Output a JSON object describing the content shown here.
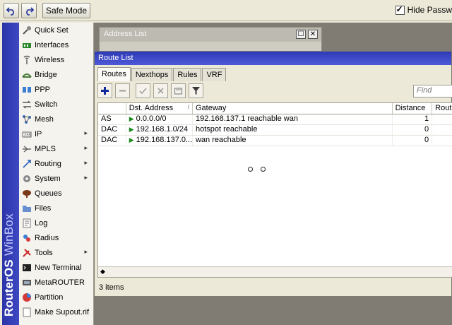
{
  "toolbar": {
    "undo_icon": "undo-icon",
    "redo_icon": "redo-icon",
    "safe_mode": "Safe Mode",
    "hide_passwords": "Hide Passw"
  },
  "brand": {
    "part1": "RouterOS",
    "part2": " WinBox"
  },
  "menu": {
    "items": [
      {
        "label": "Quick Set",
        "icon": "quickset-icon",
        "submenu": false
      },
      {
        "label": "Interfaces",
        "icon": "interfaces-icon",
        "submenu": false
      },
      {
        "label": "Wireless",
        "icon": "wireless-icon",
        "submenu": false
      },
      {
        "label": "Bridge",
        "icon": "bridge-icon",
        "submenu": false
      },
      {
        "label": "PPP",
        "icon": "ppp-icon",
        "submenu": false
      },
      {
        "label": "Switch",
        "icon": "switch-icon",
        "submenu": false
      },
      {
        "label": "Mesh",
        "icon": "mesh-icon",
        "submenu": false
      },
      {
        "label": "IP",
        "icon": "ip-icon",
        "submenu": true
      },
      {
        "label": "MPLS",
        "icon": "mpls-icon",
        "submenu": true
      },
      {
        "label": "Routing",
        "icon": "routing-icon",
        "submenu": true
      },
      {
        "label": "System",
        "icon": "system-icon",
        "submenu": true
      },
      {
        "label": "Queues",
        "icon": "queues-icon",
        "submenu": false
      },
      {
        "label": "Files",
        "icon": "files-icon",
        "submenu": false
      },
      {
        "label": "Log",
        "icon": "log-icon",
        "submenu": false
      },
      {
        "label": "Radius",
        "icon": "radius-icon",
        "submenu": false
      },
      {
        "label": "Tools",
        "icon": "tools-icon",
        "submenu": true
      },
      {
        "label": "New Terminal",
        "icon": "terminal-icon",
        "submenu": false
      },
      {
        "label": "MetaROUTER",
        "icon": "metarouter-icon",
        "submenu": false
      },
      {
        "label": "Partition",
        "icon": "partition-icon",
        "submenu": false
      },
      {
        "label": "Make Supout.rif",
        "icon": "supout-icon",
        "submenu": false
      }
    ]
  },
  "address_list": {
    "title": "Address List"
  },
  "route_list": {
    "title": "Route List",
    "tabs": [
      "Routes",
      "Nexthops",
      "Rules",
      "VRF"
    ],
    "find_placeholder": "Find",
    "columns": [
      "",
      "Dst. Address",
      "Gateway",
      "Distance",
      "Routi"
    ],
    "rows": [
      {
        "flag": "AS",
        "dst": "0.0.0.0/0",
        "gateway": "192.168.137.1 reachable wan",
        "distance": "1"
      },
      {
        "flag": "DAC",
        "dst": "192.168.1.0/24",
        "gateway": "hotspot reachable",
        "distance": "0"
      },
      {
        "flag": "DAC",
        "dst": "192.168.137.0...",
        "gateway": "wan reachable",
        "distance": "0"
      }
    ],
    "status": "3 items"
  },
  "colors": {
    "title_bar": "#3440bf",
    "left_band": "#2c34a8",
    "workspace": "#807c74"
  }
}
